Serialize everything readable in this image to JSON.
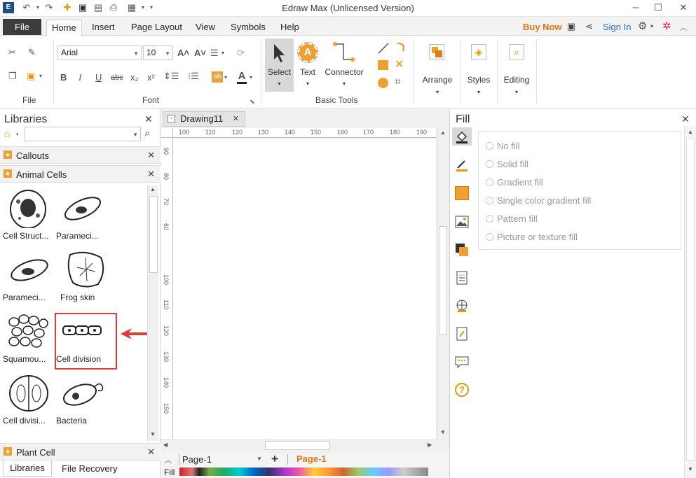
{
  "app": {
    "title": "Edraw Max (Unlicensed Version)"
  },
  "menu": {
    "file": "File",
    "tabs": [
      "Home",
      "Insert",
      "Page Layout",
      "View",
      "Symbols",
      "Help"
    ],
    "buy_now": "Buy Now",
    "sign_in": "Sign In"
  },
  "ribbon": {
    "font_name": "Arial",
    "font_size": "10",
    "groups": {
      "file": "File",
      "font": "Font",
      "basic_tools": "Basic Tools"
    },
    "select": "Select",
    "text": "Text",
    "connector": "Connector",
    "arrange": "Arrange",
    "styles": "Styles",
    "editing": "Editing",
    "format_buttons": [
      "B",
      "I",
      "U",
      "abc",
      "x₂",
      "x²"
    ]
  },
  "libraries": {
    "title": "Libraries",
    "search_placeholder": "",
    "callouts": "Callouts",
    "animal_cells": "Animal Cells",
    "plant_cell": "Plant Cell",
    "shapes": [
      "Cell Struct...",
      "Parameci...",
      "Parameci...",
      "Frog skin",
      "Squamou...",
      "Cell division",
      "Cell divisi...",
      "Bacteria"
    ],
    "bottom_tabs": [
      "Libraries",
      "File Recovery"
    ]
  },
  "canvas": {
    "doc_tab": "Drawing11",
    "hruler": [
      "100",
      "110",
      "120",
      "130",
      "140",
      "150",
      "160",
      "170",
      "180",
      "190"
    ],
    "vruler": [
      "90",
      "80",
      "70",
      "60",
      "100",
      "110",
      "120",
      "130",
      "140",
      "150"
    ],
    "page_select": "Page-1",
    "page_tab": "Page-1",
    "fill_label": "Fill"
  },
  "fill_panel": {
    "title": "Fill",
    "options": [
      "No fill",
      "Solid fill",
      "Gradient fill",
      "Single color gradient fill",
      "Pattern fill",
      "Picture or texture fill"
    ]
  },
  "colors": {
    "accent": "#e8760c",
    "highlight": "#e53935",
    "file_tab": "#3c3c3c",
    "link": "#2a6ebd"
  }
}
